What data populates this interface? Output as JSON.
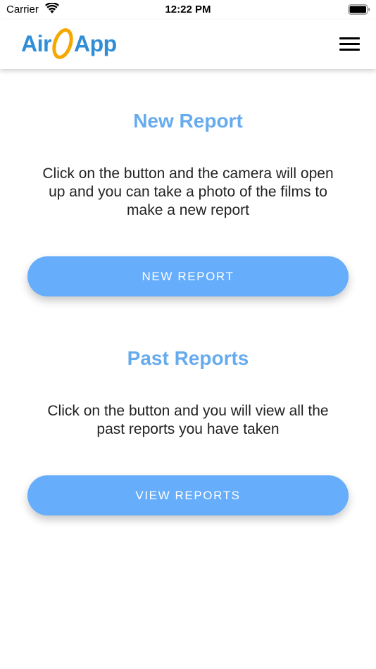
{
  "status_bar": {
    "carrier": "Carrier",
    "time": "12:22 PM",
    "wifi_icon": "wifi-icon",
    "battery_icon": "battery-full-icon"
  },
  "header": {
    "logo": {
      "text_left": "Air",
      "text_right": "App",
      "ring_icon": "ring-logo-icon",
      "brand_color": "#2f8ed6",
      "ring_color": "#f5a800"
    },
    "menu_icon": "hamburger-menu-icon"
  },
  "new_report": {
    "title": "New Report",
    "description": "Click on the button and the camera will open up and you can take a photo of the films to make a new report",
    "button_label": "NEW REPORT"
  },
  "past_reports": {
    "title": "Past Reports",
    "description": "Click on the button and you will view all the past reports you have taken",
    "button_label": "VIEW REPORTS"
  },
  "colors": {
    "title": "#66abee",
    "button": "#66adfb",
    "button_text": "#ffffff"
  }
}
